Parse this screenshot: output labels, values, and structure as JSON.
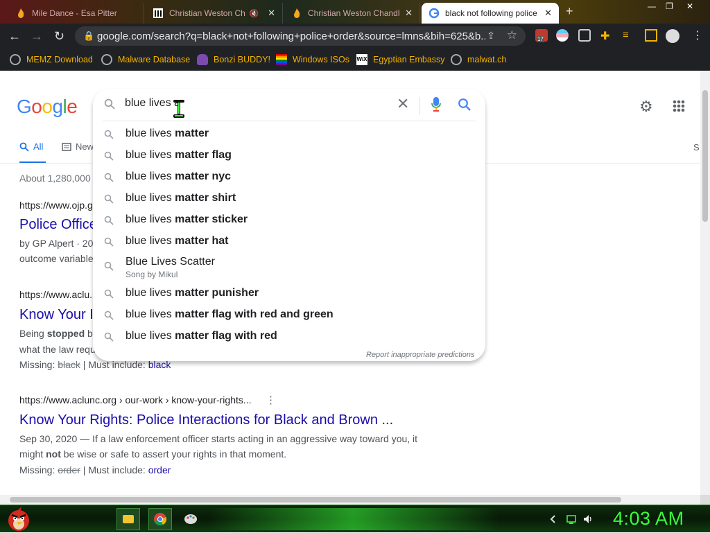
{
  "browser": {
    "tabs": [
      {
        "title": "Mile Dance - Esa Pitter"
      },
      {
        "title": "Christian Weston Ch"
      },
      {
        "title": "Christian Weston Chandl"
      },
      {
        "title": "black not following police"
      }
    ],
    "url": "google.com/search?q=black+not+following+police+order&source=lmns&bih=625&b...",
    "extension_badge": "17",
    "bookmarks": [
      {
        "label": "MEMZ Download",
        "icon": "globe-icon"
      },
      {
        "label": "Malware Database",
        "icon": "globe-icon"
      },
      {
        "label": "Bonzi BUDDY!",
        "icon": "bonzi-icon"
      },
      {
        "label": "Windows ISOs",
        "icon": "windows-flag-icon"
      },
      {
        "label": "Egyptian Embassy",
        "icon": "wix-icon"
      },
      {
        "label": "malwat.ch",
        "icon": "globe-icon"
      }
    ]
  },
  "google": {
    "logo": "Google",
    "tabs": [
      {
        "label": "All"
      },
      {
        "label": "New"
      }
    ],
    "right_tab_fragment": "S",
    "stats": "About 1,280,000",
    "search": {
      "query": "blue lives a",
      "report_text": "Report inappropriate predictions",
      "suggestions": [
        {
          "prefix": "blue lives ",
          "bold": "matter"
        },
        {
          "prefix": "blue lives ",
          "bold": "matter flag"
        },
        {
          "prefix": "blue lives ",
          "bold": "matter nyc"
        },
        {
          "prefix": "blue lives ",
          "bold": "matter shirt"
        },
        {
          "prefix": "blue lives ",
          "bold": "matter sticker"
        },
        {
          "prefix": "blue lives ",
          "bold": "matter hat"
        },
        {
          "prefix": "Blue Lives Scatter",
          "bold": "",
          "subtitle": "Song by Mikul"
        },
        {
          "prefix": "blue lives ",
          "bold": "matter punisher"
        },
        {
          "prefix": "blue lives ",
          "bold": "matter flag with red and green"
        },
        {
          "prefix": "blue lives ",
          "bold": "matter flag with red"
        }
      ]
    },
    "results": [
      {
        "url": "https://www.ojp.g",
        "title": "Police Office",
        "snippet1_a": "by GP Alpert · 20",
        "snippet2": "outcome variable"
      },
      {
        "url": "https://www.aclu.",
        "title": "Know Your I",
        "snippet1_a": "Being ",
        "snippet1_b": "stopped",
        "snippet1_c": " by",
        "snippet2": "what the law requ",
        "missing_label": "Missing: ",
        "missing_word": "black",
        "include_label": " | Must include: ",
        "include_word": "black"
      },
      {
        "url": "https://www.aclunc.org › our-work › know-your-rights...",
        "title": "Know Your Rights: Police Interactions for Black and Brown ...",
        "snippet1_a": "Sep 30, 2020 — If a law enforcement officer starts acting in an aggressive way toward you, it",
        "snippet2_a": "might ",
        "snippet2_b": "not",
        "snippet2_c": " be wise or safe to assert your rights in that moment.",
        "missing_label": "Missing: ",
        "missing_word": "order",
        "include_label": " | Must include: ",
        "include_word": "order"
      }
    ]
  },
  "taskbar": {
    "clock": "4:03 AM",
    "apps": [
      {
        "icon": "folder-icon"
      },
      {
        "icon": "chrome-icon"
      },
      {
        "icon": "paint-icon"
      }
    ]
  },
  "colors": {
    "link": "#1a0dab",
    "accent": "#1a73e8",
    "bookmark_text": "#f4b400",
    "clock": "#3aff3a"
  }
}
